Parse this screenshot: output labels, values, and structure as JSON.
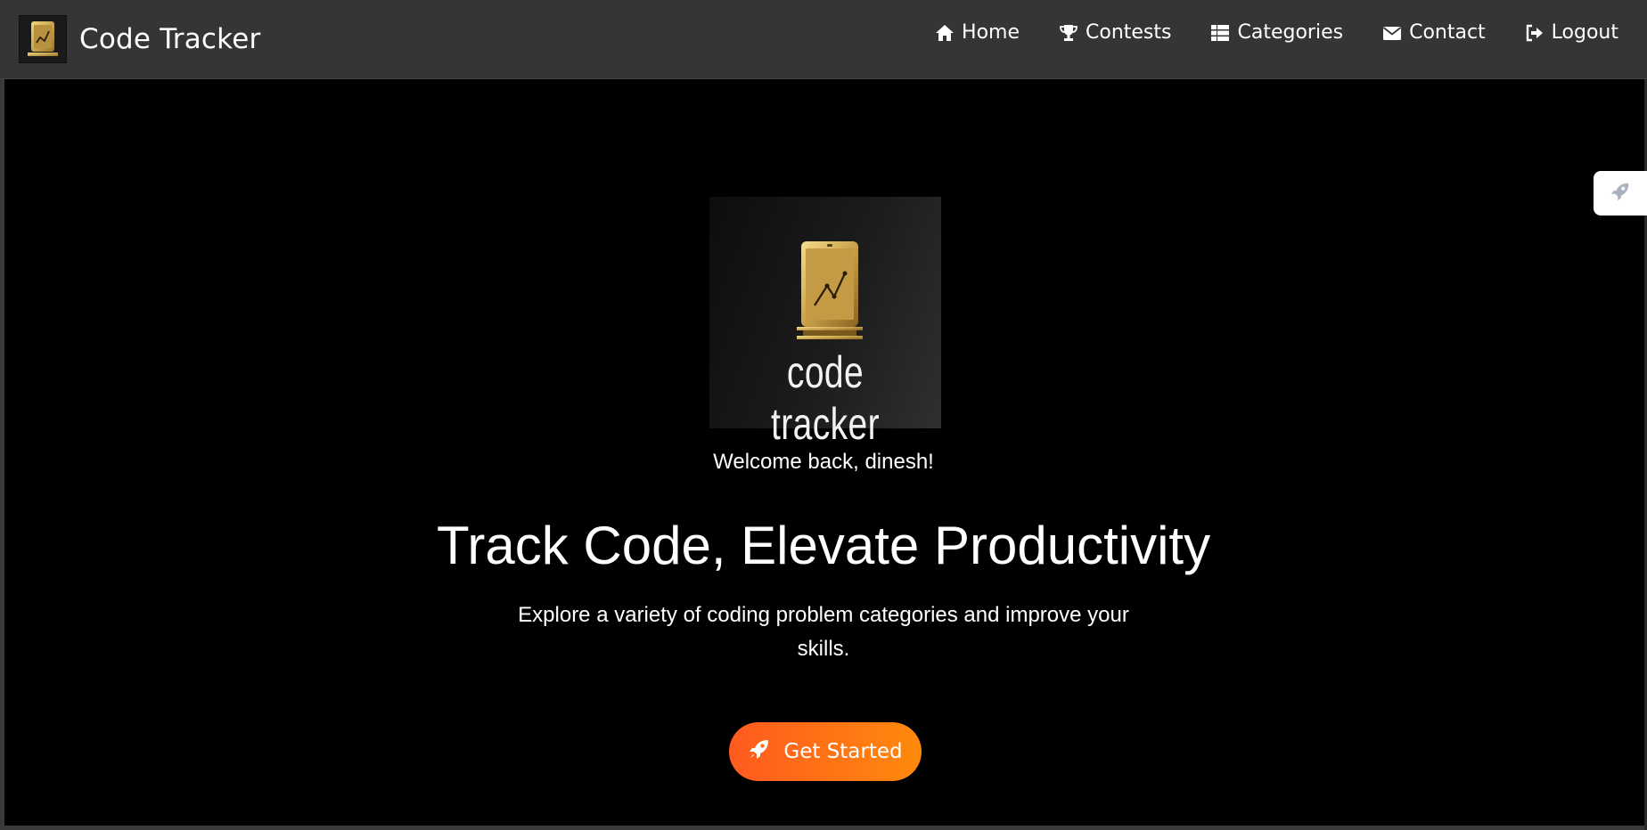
{
  "navbar": {
    "brand_title": "Code Tracker",
    "items": [
      {
        "label": "Home",
        "icon": "home-icon"
      },
      {
        "label": "Contests",
        "icon": "trophy-icon"
      },
      {
        "label": "Categories",
        "icon": "list-icon"
      },
      {
        "label": "Contact",
        "icon": "envelope-icon"
      },
      {
        "label": "Logout",
        "icon": "sign-out-icon"
      }
    ]
  },
  "hero": {
    "logo_text": "code tracker",
    "welcome": "Welcome back, dinesh!",
    "headline": "Track Code, Elevate Productivity",
    "subtitle": "Explore a variety of coding problem categories and improve your skills.",
    "cta_label": "Get Started",
    "cta_icon": "rocket-icon"
  },
  "side_tab": {
    "icon": "rocket-icon"
  },
  "colors": {
    "navbar_bg": "#353535",
    "page_bg": "#000000",
    "cta_start": "#ff5a1f",
    "cta_end": "#ff8a0c",
    "logo_gold": "#c9a24a"
  }
}
